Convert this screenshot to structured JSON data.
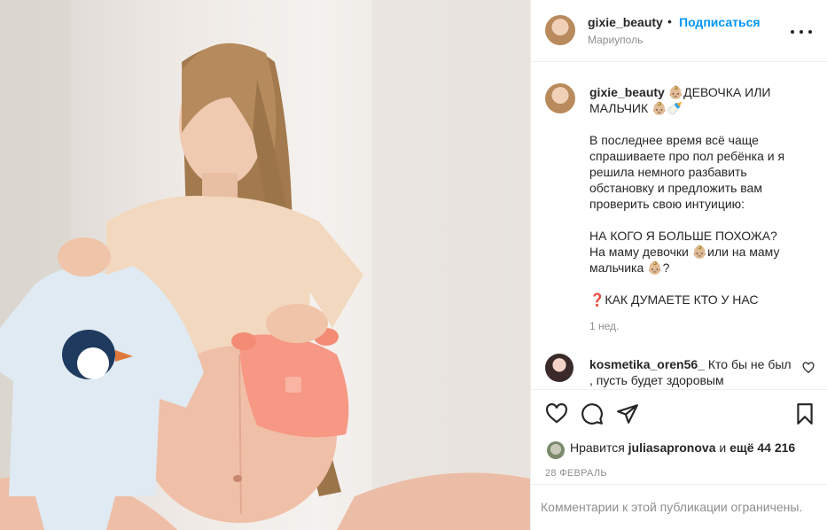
{
  "post": {
    "username": "gixie_beauty",
    "separator": "•",
    "follow_label": "Подписаться",
    "location": "Мариуполь"
  },
  "caption": {
    "username": "gixie_beauty",
    "title": " 👶🏼ДЕВОЧКА ИЛИ МАЛЬЧИК 👶🏼🍼",
    "paragraph1": "В последнее время всё чаще спрашиваете про пол ребёнка и я решила немного разбавить обстановку и предложить вам проверить свою интуицию:",
    "paragraph2": "НА КОГО Я БОЛЬШЕ ПОХОЖА?\nНа маму девочки 👶🏼или на маму мальчика 👶🏼?",
    "paragraph3": "❓КАК ДУМАЕТЕ КТО У НАС",
    "time": "1 нед."
  },
  "comment": {
    "username": "kosmetika_oren56_",
    "text": " Кто бы не был , пусть будет здоровым"
  },
  "likes": {
    "prefix": "Нравится ",
    "user": "juliasapronova",
    "middle": " и ",
    "count": "ещё 44 216"
  },
  "date": "28 ФЕВРАЛЬ",
  "comments_restricted": "Комментарии к этой публикации ограничены.",
  "icons": {
    "like": "heart-icon",
    "comment": "comment-icon",
    "share": "share-icon",
    "save": "bookmark-icon",
    "more": "more-icon"
  },
  "colors": {
    "link": "#0095f6",
    "muted": "#8e8e8e",
    "text": "#262626"
  }
}
